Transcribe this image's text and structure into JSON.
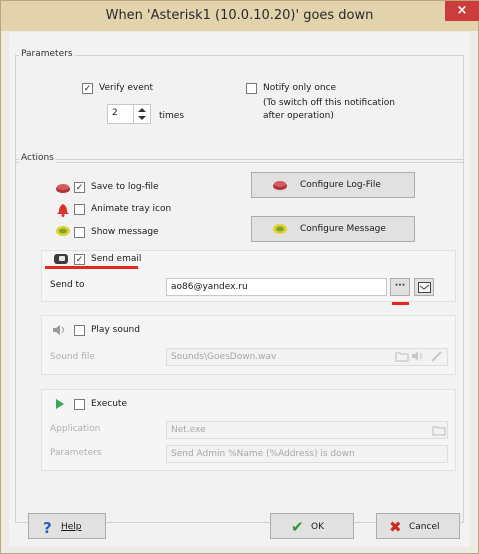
{
  "window": {
    "title": "When 'Asterisk1 (10.0.10.20)' goes down",
    "close_glyph": "×"
  },
  "parameters": {
    "group_title": "Parameters",
    "verify_event": {
      "label": "Verify event",
      "checked": true
    },
    "times_value": "2",
    "times_label": "times",
    "notify_once": {
      "label": "Notify only once",
      "checked": false
    },
    "notify_note_line1": "(To switch off this notification",
    "notify_note_line2": "after operation)"
  },
  "actions": {
    "group_title": "Actions",
    "save_to_log": {
      "label": "Save to log-file",
      "checked": true
    },
    "animate_tray": {
      "label": "Animate tray icon",
      "checked": false
    },
    "show_message": {
      "label": "Show message",
      "checked": false
    },
    "configure_log_button": "Configure Log-File",
    "configure_message_button": "Configure Message",
    "send_email": {
      "label": "Send email",
      "checked": true,
      "send_to_label": "Send to",
      "send_to_value": "ao86@yandex.ru",
      "browse_glyph": "···"
    },
    "play_sound": {
      "label": "Play sound",
      "checked": false,
      "sound_file_label": "Sound file",
      "sound_file_value": "Sounds\\GoesDown.wav"
    },
    "execute": {
      "label": "Execute",
      "checked": false,
      "application_label": "Application",
      "application_value": "Net.exe",
      "parameters_label": "Parameters",
      "parameters_value": "Send Admin %Name (%Address) is down"
    }
  },
  "footer": {
    "help_label": "Help",
    "ok_label": "OK",
    "cancel_label": "Cancel"
  },
  "colors": {
    "title_bar": "#e3d3ad",
    "close_button": "#cd3c3c",
    "highlight_underline": "#e8261d"
  }
}
